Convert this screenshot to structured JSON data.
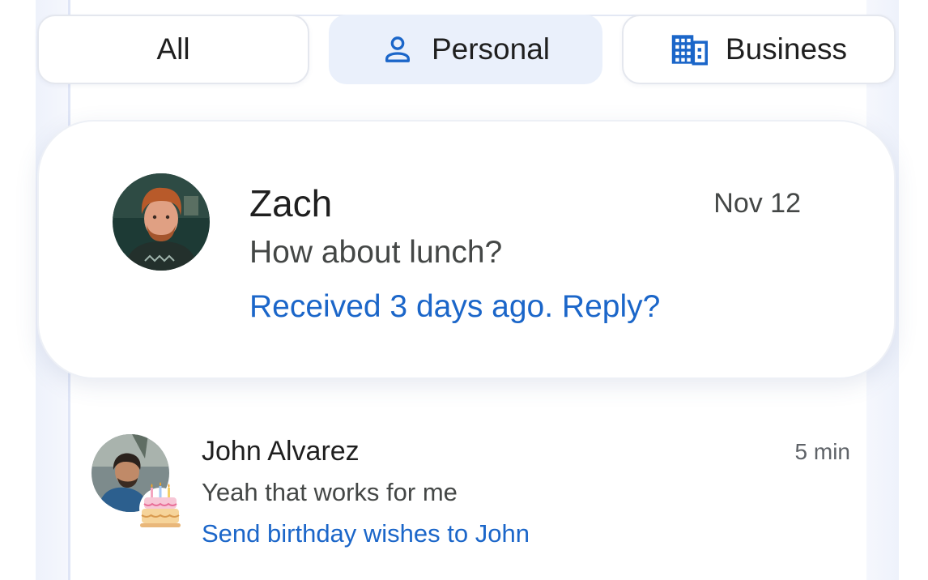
{
  "filters": {
    "all_label": "All",
    "personal_label": "Personal",
    "business_label": "Business",
    "selected": "Personal",
    "personal_icon": "person-icon",
    "business_icon": "building-icon"
  },
  "highlighted_message": {
    "sender": "Zach",
    "date": "Nov 12",
    "preview": "How about lunch?",
    "nudge": "Received 3 days ago. Reply?"
  },
  "messages": [
    {
      "sender": "John Alvarez",
      "time": "5 min",
      "preview": "Yeah that works for me",
      "suggestion": "Send birthday wishes to John",
      "badge_icon": "birthday-cake-icon"
    }
  ],
  "colors": {
    "accent": "#1b66c9",
    "chip_selected_bg": "#eaf0fb",
    "text_primary": "#1f1f1f",
    "text_secondary": "#444746"
  }
}
